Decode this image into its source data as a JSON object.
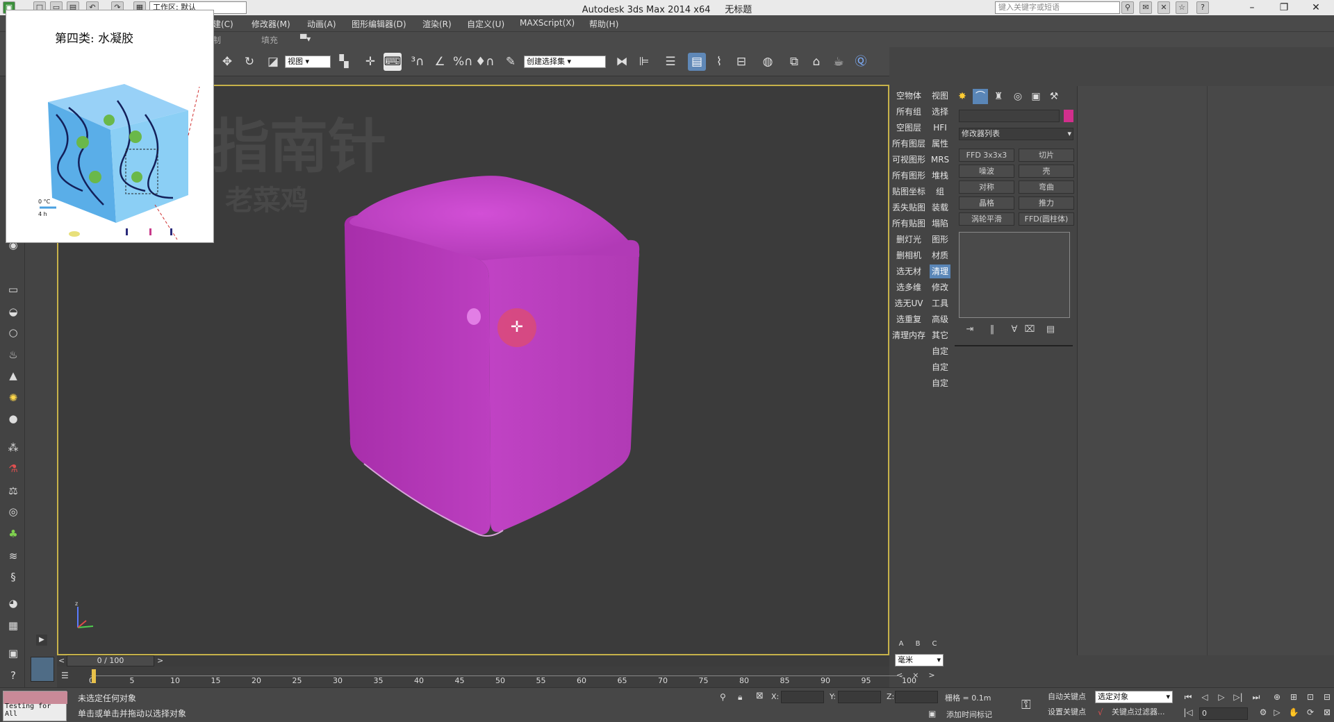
{
  "app": {
    "title": "Autodesk 3ds Max  2014 x64",
    "file": "无标题",
    "workspace": "工作区: 默认",
    "search_placeholder": "键入关键字或短语"
  },
  "menu": [
    "建(C)",
    "修改器(M)",
    "动画(A)",
    "图形编辑器(D)",
    "渲染(R)",
    "自定义(U)",
    "MAXScript(X)",
    "帮助(H)"
  ],
  "subbar": [
    "制",
    "填充"
  ],
  "toolbar": {
    "view_select": "视图",
    "selection_set": "创建选择集"
  },
  "viewport": {
    "watermark_1": "指南针",
    "watermark_2": "老菜鸡",
    "object_color": "#b93dbe"
  },
  "thumbnail": {
    "title": "第四类: 水凝胶",
    "temp_label": "0 °C",
    "time_label": "4 h"
  },
  "right_list": {
    "col1": [
      "空物体",
      "所有组",
      "空图层",
      "所有图层",
      "可视图形",
      "所有图形",
      "贴图坐标",
      "丢失贴图",
      "所有贴图",
      "删灯光",
      "删相机",
      "选无材",
      "选多维",
      "选无UV",
      "选重复",
      "清理内存"
    ],
    "col2": [
      "视图",
      "选择",
      "HFI",
      "属性",
      "MRS",
      "堆栈",
      "组",
      "装载",
      "塌陷",
      "图形",
      "材质",
      "清理",
      "修改",
      "工具",
      "高级",
      "其它",
      "自定",
      "自定",
      "自定"
    ],
    "col2_active": "清理"
  },
  "command_panel": {
    "color_swatch": "#d12f8c",
    "modifier_list": "修改器列表",
    "modifier_buttons": [
      "FFD 3x3x3",
      "切片",
      "噪波",
      "壳",
      "对称",
      "弯曲",
      "晶格",
      "推力",
      "涡轮平滑",
      "FFD(圆柱体)"
    ]
  },
  "bottom": {
    "abc": [
      "A",
      "B",
      "C"
    ],
    "units": "毫米",
    "frame_range": "0 / 100",
    "ticks": [
      "0",
      "5",
      "10",
      "15",
      "20",
      "25",
      "30",
      "35",
      "40",
      "45",
      "50",
      "55",
      "60",
      "65",
      "70",
      "75",
      "80",
      "85",
      "90",
      "95",
      "100"
    ],
    "status_line1": "未选定任何对象",
    "status_line2": "单击或单击并拖动以选择对象",
    "maxscript_label": "Testing for All",
    "x_label": "X:",
    "y_label": "Y:",
    "z_label": "Z:",
    "grid": "栅格 = 0.1m",
    "add_time_tag": "添加时间标记",
    "auto_key": "自动关键点",
    "set_key": "设置关键点",
    "selected_object": "选定对象",
    "key_filters": "关键点过滤器...",
    "current_frame": "0"
  }
}
